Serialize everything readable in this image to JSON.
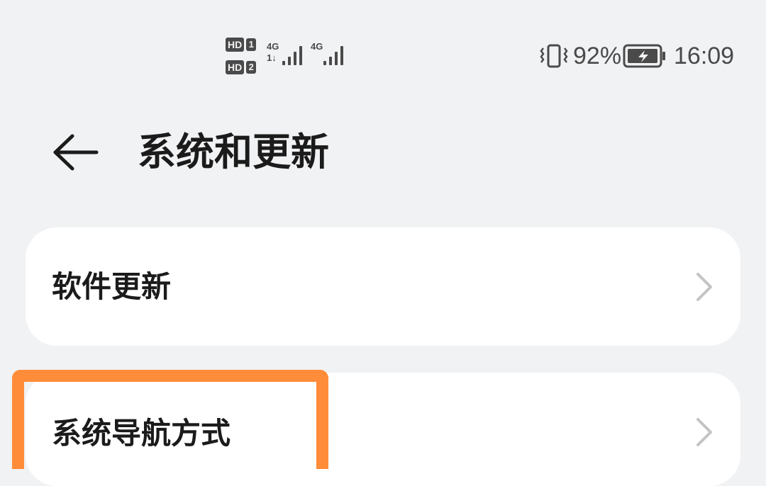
{
  "status_bar": {
    "sim1_badge": "HD",
    "sim1_num": "1",
    "sim2_badge": "HD",
    "sim2_num": "2",
    "network1": "4G",
    "network2": "4G",
    "data_activity": "1↓",
    "battery_percent": "92%",
    "time": "16:09",
    "icons": [
      "vibrate-icon",
      "signal-icon",
      "battery-charging-icon"
    ]
  },
  "header": {
    "title": "系统和更新",
    "back_icon": "back-arrow-icon"
  },
  "settings_items": [
    {
      "label": "软件更新",
      "icon": "chevron-right-icon"
    },
    {
      "label": "系统导航方式",
      "icon": "chevron-right-icon"
    }
  ],
  "colors": {
    "background": "#f1f2f4",
    "card": "#ffffff",
    "text": "#1b1b1b",
    "chevron": "#c4c4c4",
    "highlight": "#ff8c38"
  }
}
